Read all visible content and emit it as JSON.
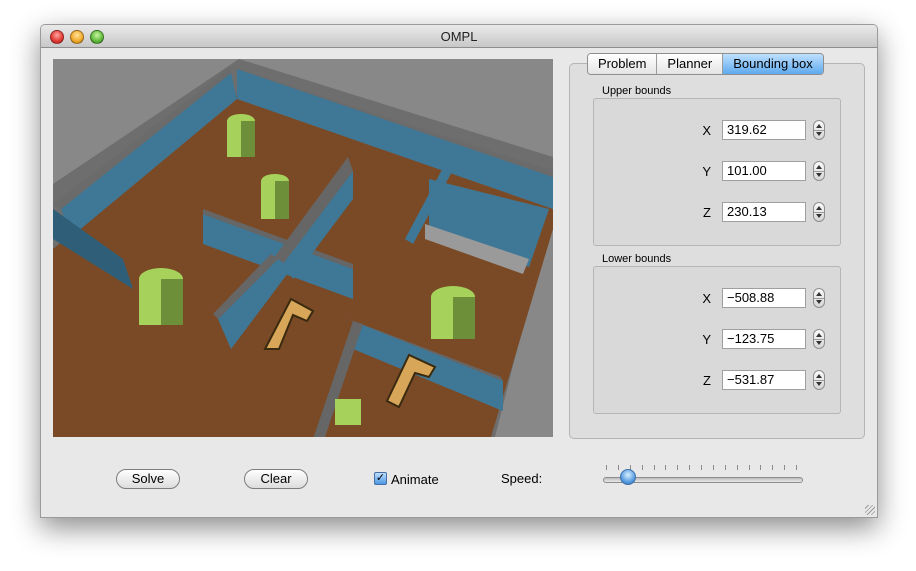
{
  "window": {
    "title": "OMPL"
  },
  "tabs": [
    {
      "label": "Problem",
      "active": false
    },
    {
      "label": "Planner",
      "active": false
    },
    {
      "label": "Bounding box",
      "active": true
    }
  ],
  "upper_bounds": {
    "label": "Upper bounds",
    "x_label": "X",
    "x": "319.62",
    "y_label": "Y",
    "y": "101.00",
    "z_label": "Z",
    "z": "230.13"
  },
  "lower_bounds": {
    "label": "Lower bounds",
    "x_label": "X",
    "x": "−508.88",
    "y_label": "Y",
    "y": "−123.75",
    "z_label": "Z",
    "z": "−531.87"
  },
  "controls": {
    "solve_label": "Solve",
    "clear_label": "Clear",
    "animate_label": "Animate",
    "animate_checked": true,
    "speed_label": "Speed:",
    "speed_level": 0.1
  },
  "colors": {
    "accent": "#5ea9ee",
    "floor": "#7a4a26",
    "wall": "#3f7896",
    "obstacle": "#a6d25c",
    "robot": "#d7a658"
  }
}
